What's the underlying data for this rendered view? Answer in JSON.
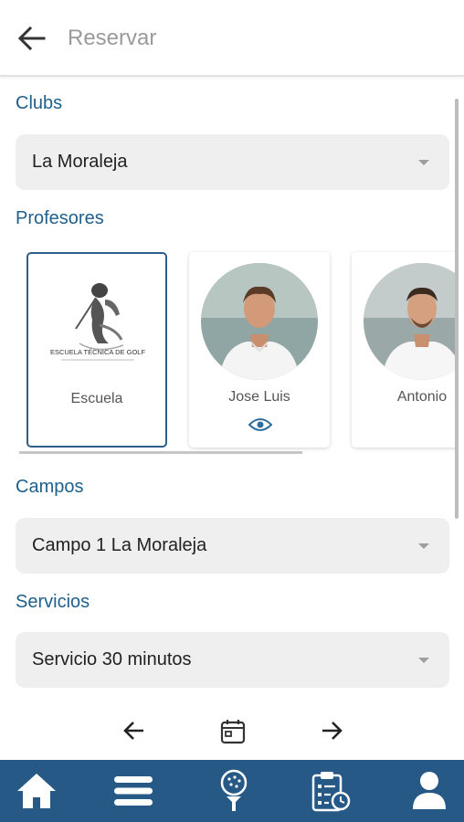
{
  "header": {
    "title": "Reservar",
    "back_icon": "arrow-left-icon"
  },
  "clubs": {
    "label": "Clubs",
    "selected": "La Moraleja"
  },
  "profesores": {
    "label": "Profesores",
    "items": [
      {
        "name": "Escuela",
        "logo_text": "ESCUELA TÉCNICA DE GOLF",
        "selected": true
      },
      {
        "name": "Jose Luis",
        "selected": false,
        "view_icon": "eye-icon"
      },
      {
        "name": "Antonio",
        "selected": false
      }
    ]
  },
  "campos": {
    "label": "Campos",
    "selected": "Campo 1 La Moraleja"
  },
  "servicios": {
    "label": "Servicios",
    "selected": "Servicio 30 minutos"
  },
  "date_nav": {
    "prev_icon": "arrow-left-icon",
    "calendar_icon": "calendar-icon",
    "next_icon": "arrow-right-icon"
  },
  "bottom_nav": {
    "items": [
      {
        "icon": "home-icon",
        "active": true
      },
      {
        "icon": "menu-icon",
        "active": false
      },
      {
        "icon": "golf-ball-tee-icon",
        "active": false
      },
      {
        "icon": "clipboard-schedule-icon",
        "active": false
      },
      {
        "icon": "user-icon",
        "active": false
      }
    ]
  },
  "colors": {
    "accent": "#1f5f8b",
    "nav_bg": "#265985",
    "select_bg": "#efefef"
  }
}
